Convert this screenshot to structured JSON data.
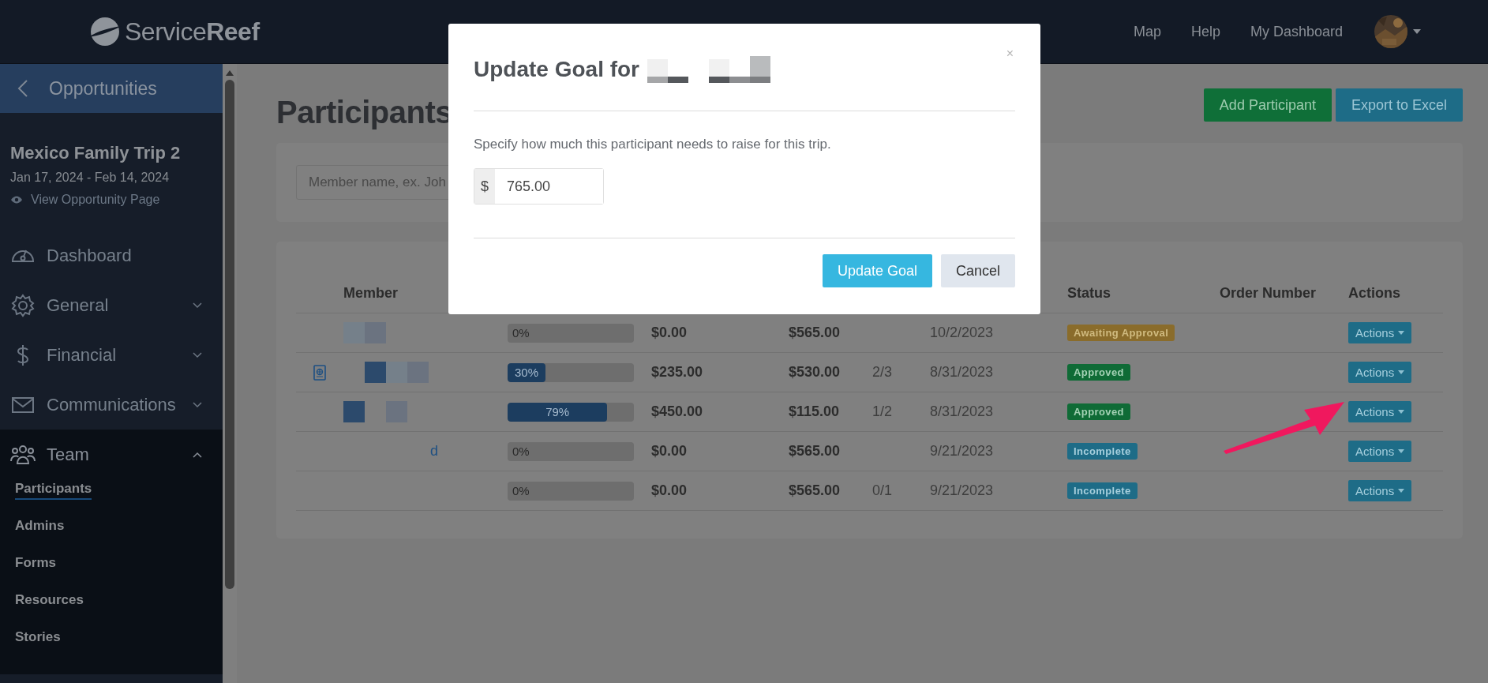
{
  "nav": {
    "logo": "Service**Reef**",
    "links": [
      "Map",
      "Help",
      "My Dashboard"
    ]
  },
  "sidebar": {
    "back": "Opportunities",
    "trip": {
      "title": "Mexico Family Trip 2",
      "dates": "Jan 17, 2024 - Feb 14, 2024",
      "view_link": "View Opportunity Page"
    },
    "items": [
      {
        "label": "Dashboard",
        "expandable": false,
        "expanded": false
      },
      {
        "label": "General",
        "expandable": true,
        "expanded": false
      },
      {
        "label": "Financial",
        "expandable": true,
        "expanded": false
      },
      {
        "label": "Communications",
        "expandable": true,
        "expanded": false
      },
      {
        "label": "Team",
        "expandable": true,
        "expanded": true,
        "children": [
          {
            "label": "Participants",
            "selected": true
          },
          {
            "label": "Admins",
            "selected": false
          },
          {
            "label": "Forms",
            "selected": false
          },
          {
            "label": "Resources",
            "selected": false
          },
          {
            "label": "Stories",
            "selected": false
          }
        ]
      }
    ]
  },
  "page": {
    "title": "Participants",
    "buttons": [
      {
        "label": "Add Participant",
        "kind": "success"
      },
      {
        "label": "Export to Excel",
        "kind": "info"
      }
    ],
    "search": {
      "placeholder": "Member name, ex. Joh"
    }
  },
  "table": {
    "columns": [
      "Member",
      "Status",
      "Order Number",
      "Actions"
    ],
    "rows": [
      {
        "passport": false,
        "progress": {
          "label": "0%"
        },
        "raised": "$0.00",
        "goal": "$565.00",
        "date": "10/2/2023",
        "status": {
          "label": "Awaiting Approval",
          "kind": "pending"
        },
        "action": "Actions"
      },
      {
        "passport": true,
        "progress": {
          "level": 0.3,
          "label": "30%"
        },
        "raised": "$235.00",
        "goal": "$530.00",
        "forms": "2/3",
        "date": "8/31/2023",
        "status": {
          "label": "Approved",
          "kind": "approved"
        },
        "action": "Actions"
      },
      {
        "passport": false,
        "progress": {
          "level": 0.79,
          "label": "79%"
        },
        "raised": "$450.00",
        "goal": "$115.00",
        "forms": "1/2",
        "date": "8/31/2023",
        "status": {
          "label": "Approved",
          "kind": "approved"
        },
        "action": "Actions"
      },
      {
        "passport": false,
        "member": "d",
        "progress": {
          "label": "0%"
        },
        "raised": "$0.00",
        "goal": "$565.00",
        "date": "9/21/2023",
        "status": {
          "label": "Incomplete",
          "kind": "incomplete"
        },
        "action": "Actions"
      },
      {
        "passport": false,
        "progress": {
          "label": "0%"
        },
        "raised": "$0.00",
        "goal": "$565.00",
        "forms": "0/1",
        "date": "9/21/2023",
        "status": {
          "label": "Incomplete",
          "kind": "incomplete"
        },
        "action": "Actions"
      }
    ]
  },
  "modal": {
    "title": "Update Goal for",
    "close": "×",
    "message": "Specify how much this participant needs to raise for this trip.",
    "currency": "$",
    "value": "765.00",
    "buttons": [
      {
        "label": "Update Goal",
        "kind": "primary"
      },
      {
        "label": "Cancel",
        "kind": "default"
      }
    ]
  }
}
